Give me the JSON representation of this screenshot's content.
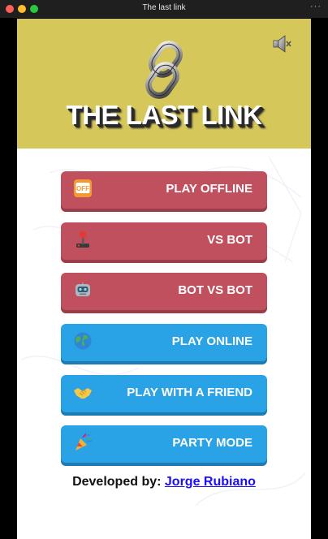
{
  "window": {
    "title": "The last link",
    "more_label": "···"
  },
  "header": {
    "title": "THE LAST LINK",
    "logo_icon": "chain-link-icon",
    "sound_icon": "speaker-muted-icon",
    "background": "#d6c75a"
  },
  "menu": [
    {
      "label": "PLAY OFFLINE",
      "icon": "offline-icon",
      "color": "#c1505f"
    },
    {
      "label": "VS BOT",
      "icon": "joystick-icon",
      "color": "#c1505f"
    },
    {
      "label": "BOT VS BOT",
      "icon": "robot-icon",
      "color": "#c1505f"
    },
    {
      "label": "PLAY ONLINE",
      "icon": "globe-icon",
      "color": "#29a3e6"
    },
    {
      "label": "PLAY WITH A FRIEND",
      "icon": "handshake-icon",
      "color": "#29a3e6"
    },
    {
      "label": "PARTY MODE",
      "icon": "party-popper-icon",
      "color": "#29a3e6"
    }
  ],
  "footer": {
    "prefix": "Developed by:",
    "author": "Jorge Rubiano"
  }
}
